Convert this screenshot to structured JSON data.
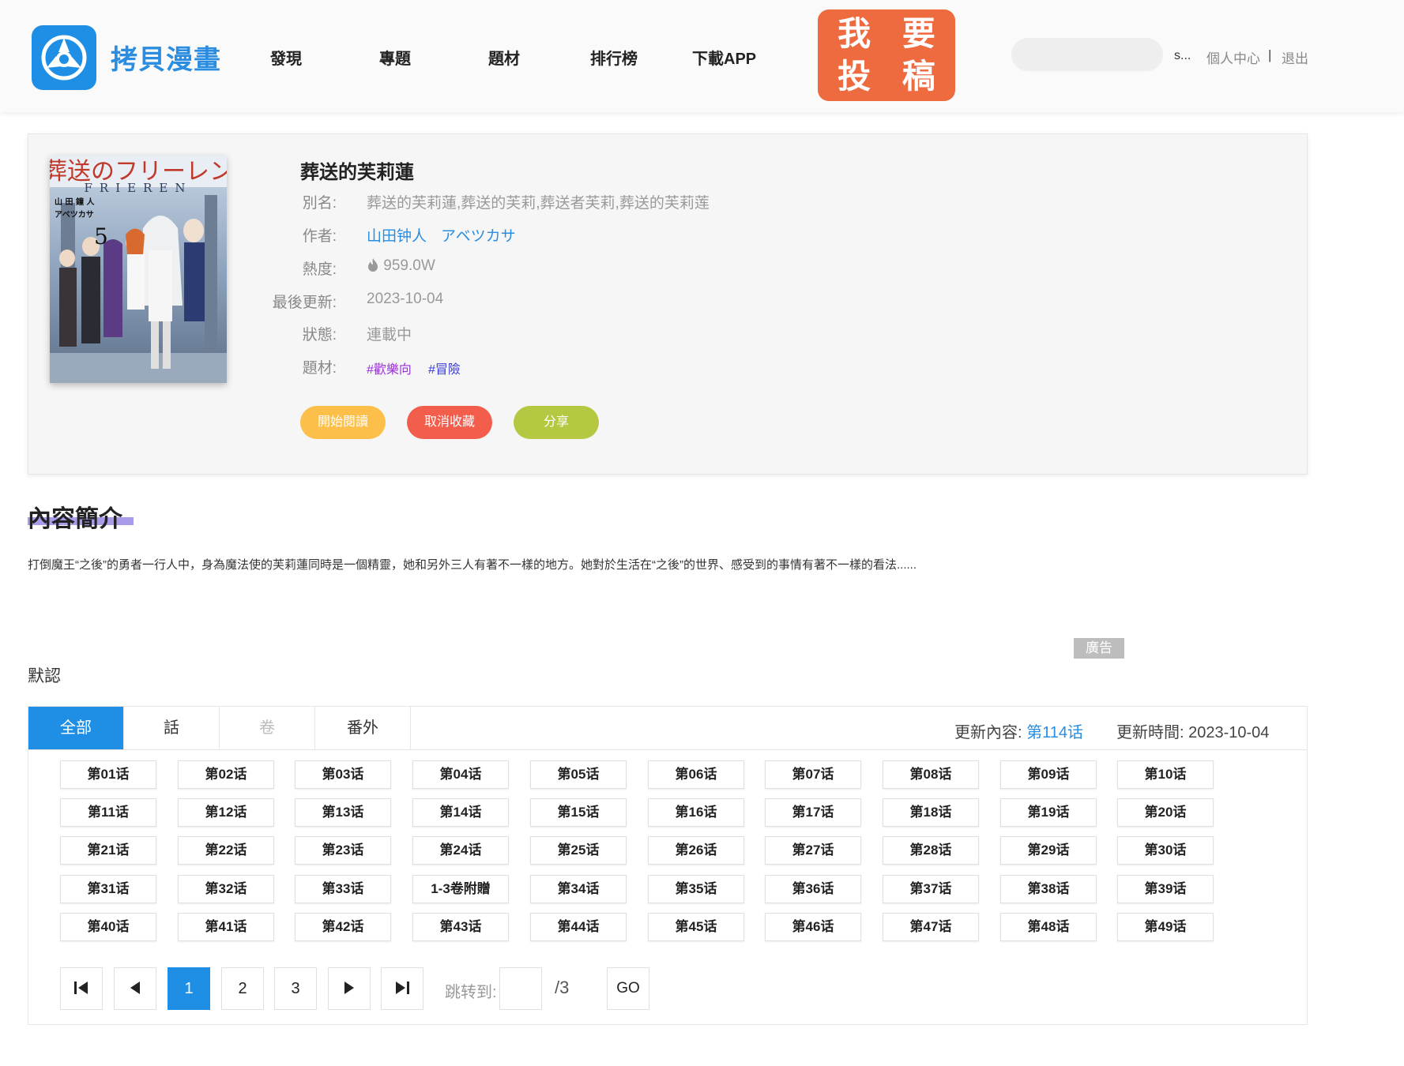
{
  "header": {
    "logo_text": "拷貝漫畫",
    "nav": [
      "發現",
      "專題",
      "題材",
      "排行榜",
      "下載APP"
    ],
    "submit_line1": "我 要",
    "submit_line2": "投 稿",
    "search_placeholder": "",
    "user_name": "s...",
    "personal_center": "個人中心",
    "separator": "|",
    "logout": "退出"
  },
  "comic": {
    "cover_title_jp": "葬送のフリーレン",
    "cover_title_en": "FRIEREN",
    "cover_volume": "5",
    "cover_author_1": "山 田 鐘 人",
    "cover_author_2": "アベツカサ",
    "title": "葬送的芙莉蓮",
    "alias_label": "別名:",
    "alias": "葬送的芙莉蓮,葬送的芙莉,葬送者芙莉,葬送的芙莉莲",
    "author_label": "作者:",
    "authors": [
      "山田钟人",
      "アベツカサ"
    ],
    "heat_label": "熱度:",
    "heat": "959.0W",
    "updated_label": "最後更新:",
    "updated": "2023-10-04",
    "status_label": "狀態:",
    "status": "連載中",
    "genre_label": "題材:",
    "tags": [
      "#歡樂向",
      "#冒險"
    ],
    "tag_colors": [
      "#9b30d9",
      "#3a3ad9"
    ],
    "buttons": {
      "start": "開始閱讀",
      "unfavorite": "取消收藏",
      "share": "分享"
    },
    "button_colors": [
      "#fcbf49",
      "#f25d4c",
      "#b6c842"
    ]
  },
  "intro": {
    "heading": "內容簡介",
    "text": "打倒魔王“之後”的勇者一行人中，身為魔法使的芙莉蓮同時是一個精靈，她和另外三人有著不一樣的地方。她對於生活在“之後”的世界、感受到的事情有著不一樣的看法......"
  },
  "ad_label": "廣告",
  "default_label": "默認",
  "chapters": {
    "tabs": [
      "全部",
      "話",
      "卷",
      "番外"
    ],
    "update_content_label": "更新內容:",
    "update_content": "第114话",
    "update_time_label": "更新時間:",
    "update_time": "2023-10-04",
    "items": [
      "第01话",
      "第02话",
      "第03话",
      "第04话",
      "第05话",
      "第06话",
      "第07话",
      "第08话",
      "第09话",
      "第10话",
      "第11话",
      "第12话",
      "第13话",
      "第14话",
      "第15话",
      "第16话",
      "第17话",
      "第18话",
      "第19话",
      "第20话",
      "第21话",
      "第22话",
      "第23话",
      "第24话",
      "第25话",
      "第26话",
      "第27话",
      "第28话",
      "第29话",
      "第30话",
      "第31话",
      "第32话",
      "第33话",
      "1-3卷附贈",
      "第34话",
      "第35话",
      "第36话",
      "第37话",
      "第38话",
      "第39话",
      "第40话",
      "第41话",
      "第42话",
      "第43话",
      "第44话",
      "第45话",
      "第46话",
      "第47话",
      "第48话",
      "第49话"
    ]
  },
  "pagination": {
    "first_icon": "first-page-icon",
    "prev_icon": "prev-page-icon",
    "pages": [
      "1",
      "2",
      "3"
    ],
    "current_page": "1",
    "next_icon": "next-page-icon",
    "last_icon": "last-page-icon",
    "jump_label": "跳转到:",
    "jump_value": "",
    "total": "/3",
    "go": "GO"
  },
  "colors": {
    "accent": "#1f8fe6",
    "submit": "#ee6a3f"
  }
}
